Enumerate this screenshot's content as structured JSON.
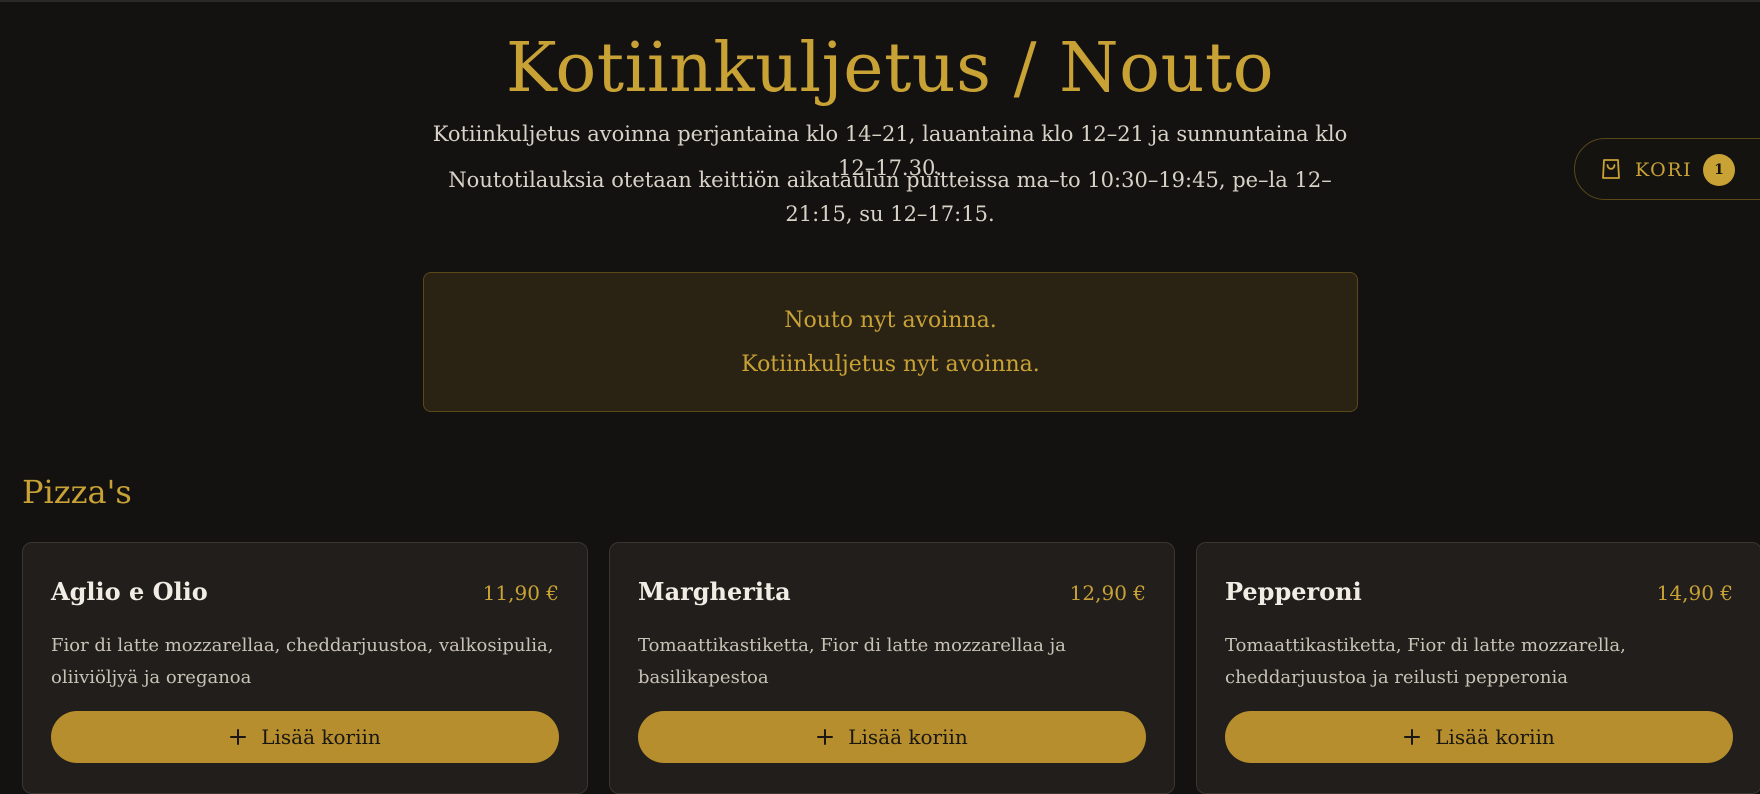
{
  "header": {
    "title": "Kotiinkuljetus / Nouto",
    "delivery_hours": "Kotiinkuljetus avoinna perjantaina klo 14–21, lauantaina klo 12–21 ja sunnuntaina klo 12–17.30.",
    "pickup_hours": "Noutotilauksia otetaan keittiön aikataulun puitteissa ma–to 10:30–19:45, pe–la 12–21:15, su 12–17:15."
  },
  "status": {
    "pickup": "Nouto nyt avoinna.",
    "delivery": "Kotiinkuljetus nyt avoinna."
  },
  "cart": {
    "icon": "shopping-bag-icon",
    "label": "KORI",
    "count": "1"
  },
  "section": {
    "title": "Pizza's"
  },
  "products": [
    {
      "name": "Aglio e Olio",
      "price": "11,90 €",
      "description": "Fior di latte mozzarellaa, cheddarjuustoa, valkosipulia, oliiviöljyä ja oreganoa",
      "button_label": "Lisää koriin"
    },
    {
      "name": "Margherita",
      "price": "12,90 €",
      "description": "Tomaattikastiketta, Fior di latte mozzarellaa ja basilikapestoa",
      "button_label": "Lisää koriin"
    },
    {
      "name": "Pepperoni",
      "price": "14,90 €",
      "description": "Tomaattikastiketta, Fior di latte mozzarella, cheddarjuustoa ja reilusti pepperonia",
      "button_label": "Lisää koriin"
    }
  ],
  "colors": {
    "background": "#131211",
    "accent": "#c9a236",
    "button": "#b68e2d",
    "card": "#211e1b",
    "status_box": "#2a2314"
  }
}
